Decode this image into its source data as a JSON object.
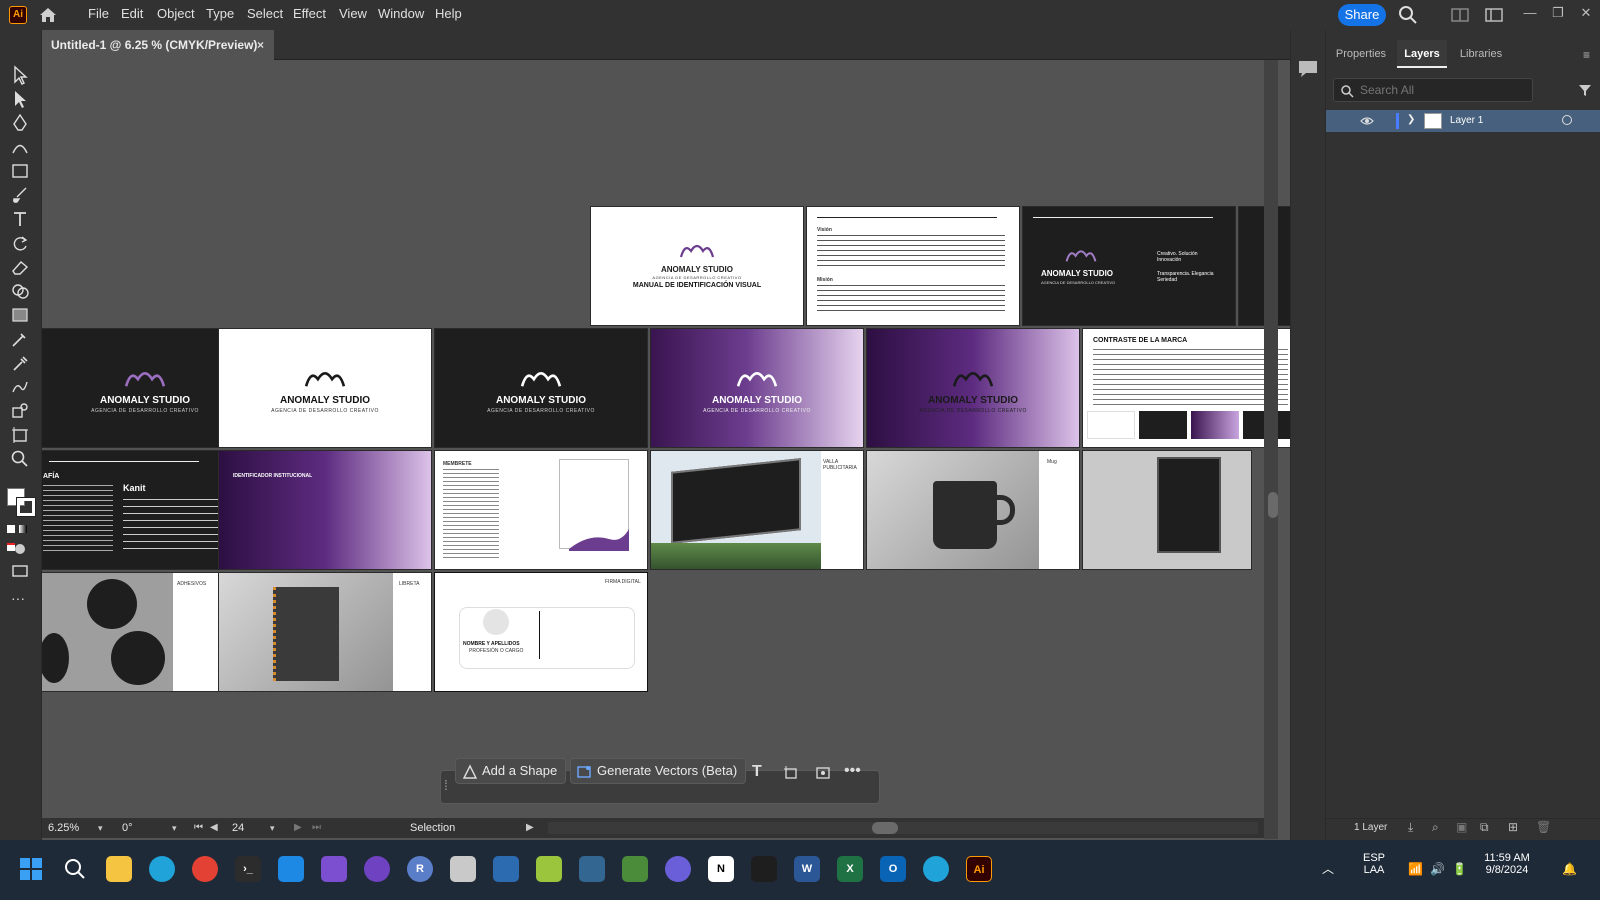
{
  "app": {
    "logo": "Ai",
    "menus": [
      "File",
      "Edit",
      "Object",
      "Type",
      "Select",
      "Effect",
      "View",
      "Window",
      "Help"
    ],
    "share_label": "Share"
  },
  "document": {
    "tab_title": "Untitled-1 @ 6.25 % (CMYK/Preview)",
    "close_glyph": "×"
  },
  "artboards": {
    "brand_name": "ANOMALY STUDIO",
    "brand_tagline": "AGENCIA DE DESARROLLO CREATIVO",
    "cover_subtitle": "MANUAL DE IDENTIFICACIÓN VISUAL",
    "vision_heading": "Visión",
    "mission_heading": "Misión",
    "values": [
      "Creativo. Solución Innovación",
      "Transparencia. Elegancia Seriedad"
    ],
    "contrast_title": "CONTRASTE DE LA MARCA",
    "typography_font": "Kanit",
    "typography_label": "AFÍA",
    "institutional_title": "IDENTIFICADOR INSTITUCIONAL",
    "letterhead_label": "MEMBRETE",
    "billboard_label": "VALLA PUBLICITARIA",
    "mug_label": "Mug",
    "stickers_label": "ADHESIVOS",
    "notebook_label": "LIBRETA",
    "signature_label": "FIRMA DIGITAL",
    "signature_name": "NOMBRE Y APELLIDOS",
    "signature_role": "PROFESIÓN O CARGO"
  },
  "statusbar": {
    "zoom": "6.25%",
    "rotation": "0°",
    "artboard_number": "24",
    "mode": "Selection"
  },
  "context_bar": {
    "add_shape": "Add a Shape",
    "generate_vectors": "Generate Vectors (Beta)"
  },
  "panel": {
    "tabs": [
      "Properties",
      "Layers",
      "Libraries"
    ],
    "search_placeholder": "Search All",
    "layer_name": "Layer 1",
    "footer_count": "1 Layer"
  },
  "taskbar": {
    "lang_line1": "ESP",
    "lang_line2": "LAA",
    "time": "11:59 AM",
    "date": "9/8/2024"
  },
  "colors": {
    "accent": "#1473e6",
    "brand_purple": "#6c3d8e",
    "ai_orange": "#ff9a00"
  }
}
